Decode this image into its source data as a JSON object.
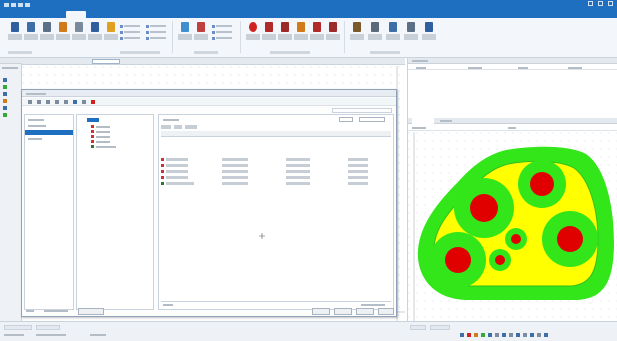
{
  "colors": {
    "accent": "#1f6fc0",
    "ribbon_bg": "#f3f6fa",
    "domain_green": "#33e61a",
    "domain_yellow": "#ffff00",
    "conductor_red": "#e00000"
  },
  "icons": [
    "save-icon",
    "undo-icon",
    "redo-icon",
    "close-icon",
    "minimize-icon",
    "maximize-icon"
  ]
}
